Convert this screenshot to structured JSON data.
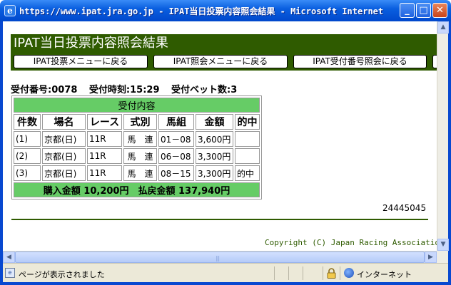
{
  "window": {
    "title": "https://www.ipat.jra.go.jp - IPAT当日投票内容照会結果 - Microsoft Internet Ex...",
    "icon_glyph": "e",
    "min_glyph": "_",
    "max_glyph": "□",
    "close_glyph": "✕"
  },
  "page": {
    "heading": "IPAT当日投票内容照会結果",
    "nav_buttons": [
      "IPAT投票メニューに戻る",
      "IPAT照会メニューに戻る",
      "IPAT受付番号照会に戻る"
    ],
    "receipt": {
      "number": "受付番号:0078",
      "time": "受付時刻:15:29",
      "bets": "受付ベット数:3"
    },
    "table": {
      "caption": "受付内容",
      "headers": [
        "件数",
        "場名",
        "レース",
        "式別",
        "馬組",
        "金額",
        "的中"
      ],
      "rows": [
        [
          "(1)",
          "京都(日)",
          "11R",
          "馬　連",
          "01－08",
          "3,600円",
          ""
        ],
        [
          "(2)",
          "京都(日)",
          "11R",
          "馬　連",
          "06－08",
          "3,300円",
          ""
        ],
        [
          "(3)",
          "京都(日)",
          "11R",
          "馬　連",
          "08－15",
          "3,300円",
          "的中"
        ]
      ],
      "total": "購入金額 10,200円　払戻金額 137,940円"
    },
    "serial": "24445045",
    "copyright": "Copyright (C) Japan Racing Association."
  },
  "scrollbar": {
    "up_glyph": "▲",
    "down_glyph": "▼",
    "left_glyph": "◀",
    "right_glyph": "▶",
    "grip_glyph": "|||"
  },
  "statusbar": {
    "text": "ページが表示されました",
    "zone": "インターネット",
    "status_icon": "e"
  },
  "colors": {
    "header_bg": "#2f5b00",
    "table_accent": "#66cc66",
    "titlebar": "#0a5fe0"
  }
}
